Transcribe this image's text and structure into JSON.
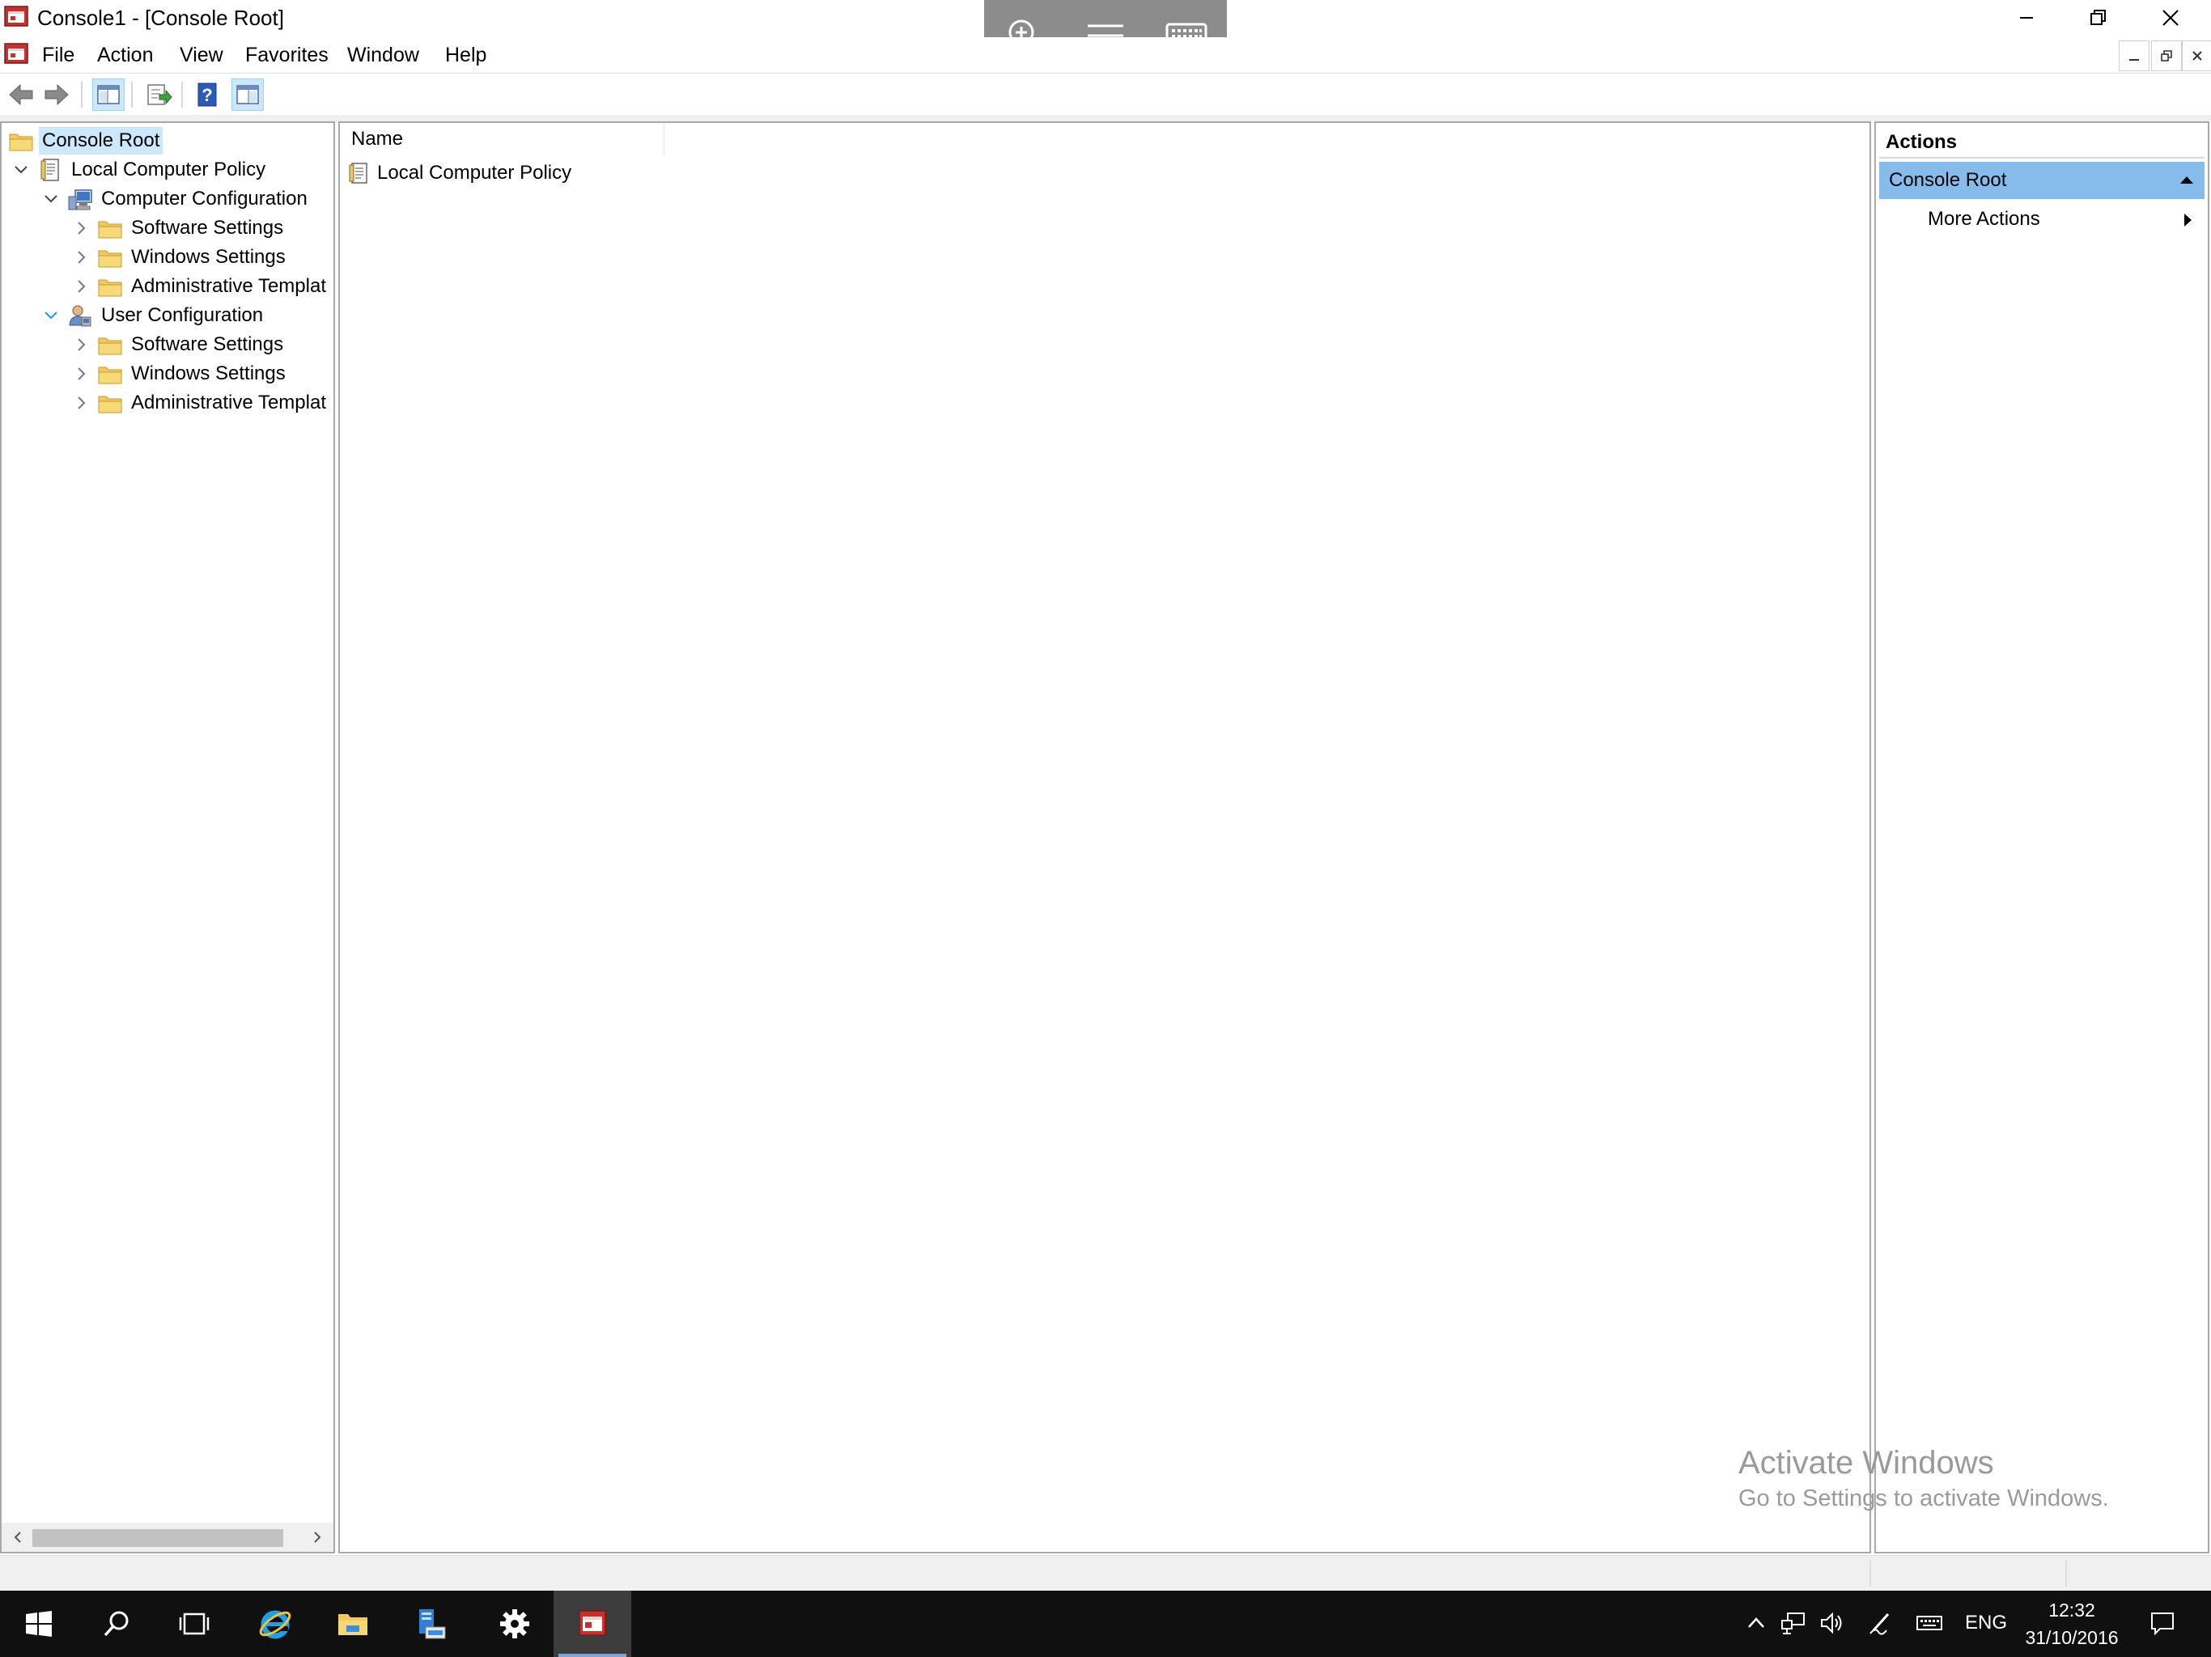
{
  "window": {
    "title": "Console1 - [Console Root]",
    "controls": [
      "minimize",
      "restore",
      "close"
    ]
  },
  "touch_toolbar": {
    "icons": [
      "zoom-icon",
      "menu-lines-icon",
      "keyboard-icon"
    ]
  },
  "menu": {
    "items": [
      "File",
      "Action",
      "View",
      "Favorites",
      "Window",
      "Help"
    ]
  },
  "toolbar": {
    "icons": [
      "back-icon",
      "forward-icon",
      "show-hide-tree-icon",
      "export-list-icon",
      "help-icon",
      "show-hide-action-pane-icon"
    ]
  },
  "tree": {
    "items": [
      {
        "label": "Console Root",
        "level": 0,
        "icon": "folder-icon",
        "selected": true,
        "expander": "none"
      },
      {
        "label": "Local Computer Policy",
        "level": 0,
        "icon": "policy-icon",
        "expander": "expanded"
      },
      {
        "label": "Computer Configuration",
        "level": 1,
        "icon": "computer-config-icon",
        "expander": "expanded"
      },
      {
        "label": "Software Settings",
        "level": 2,
        "icon": "folder-icon",
        "expander": "collapsed"
      },
      {
        "label": "Windows Settings",
        "level": 2,
        "icon": "folder-icon",
        "expander": "collapsed"
      },
      {
        "label": "Administrative Templat",
        "level": 2,
        "icon": "folder-icon",
        "expander": "collapsed"
      },
      {
        "label": "User Configuration",
        "level": 1,
        "icon": "user-config-icon",
        "expander": "expanded"
      },
      {
        "label": "Software Settings",
        "level": 2,
        "icon": "folder-icon",
        "expander": "collapsed"
      },
      {
        "label": "Windows Settings",
        "level": 2,
        "icon": "folder-icon",
        "expander": "collapsed"
      },
      {
        "label": "Administrative Templat",
        "level": 2,
        "icon": "folder-icon",
        "expander": "collapsed"
      }
    ]
  },
  "results": {
    "column_name": "Name",
    "rows": [
      {
        "label": "Local Computer Policy",
        "icon": "policy-icon"
      }
    ]
  },
  "actions": {
    "header": "Actions",
    "section_title": "Console Root",
    "more_actions": "More Actions"
  },
  "watermark": {
    "title": "Activate Windows",
    "subtitle": "Go to Settings to activate Windows."
  },
  "taskbar": {
    "apps": [
      "start-icon",
      "search-icon",
      "task-view-icon",
      "internet-explorer-icon",
      "file-explorer-icon",
      "server-manager-icon",
      "settings-icon",
      "mmc-console-icon"
    ],
    "tray_icons": [
      "show-hidden-icons-chevron",
      "network-icon",
      "volume-icon",
      "pen-icon",
      "touch-keyboard-icon",
      "action-center-icon"
    ],
    "language": "ENG",
    "time": "12:32",
    "date": "31/10/2016"
  },
  "colors": {
    "selection": "#cce8ff",
    "action_section": "#86bcec",
    "taskbar": "#101010",
    "folder": "#f3c95b"
  }
}
